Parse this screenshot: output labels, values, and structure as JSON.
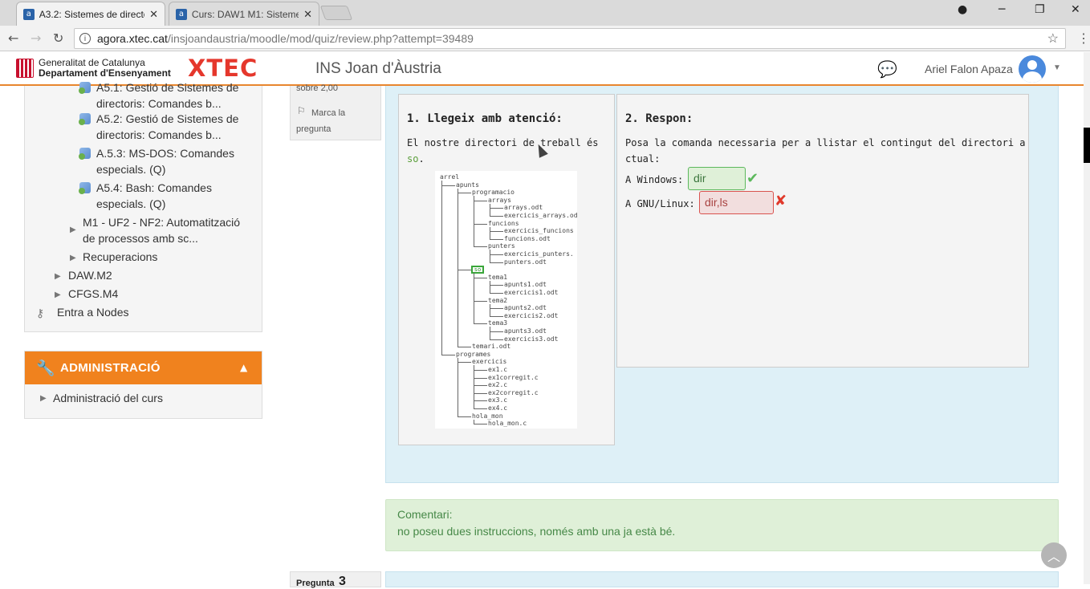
{
  "browser": {
    "tabs": [
      {
        "title": "A3.2: Sistemes de directo",
        "favicon": "a"
      },
      {
        "title": "Curs: DAW1 M1: Sistemes",
        "favicon": "a"
      }
    ],
    "url_host": "agora.xtec.cat",
    "url_path": "/insjoandaustria/moodle/mod/quiz/review.php?attempt=39489"
  },
  "header": {
    "gencat_line1": "Generalitat de Catalunya",
    "gencat_line2": "Departament d'Ensenyament",
    "xtec_logo": "XTEC",
    "site_name": "INS Joan d'Àustria",
    "user_name": "Ariel Falon Apaza",
    "chat_icon": "speech-bubble-icon"
  },
  "sidebar": {
    "items": [
      {
        "label1": "A5.1: Gestió de Sistemes de",
        "label2": "directoris: Comandes b..."
      },
      {
        "label1": "A5.2: Gestió de Sistemes de",
        "label2": "directoris: Comandes b..."
      },
      {
        "label1": "A.5.3: MS-DOS: Comandes",
        "label2": "especials. (Q)"
      },
      {
        "label1": "A5.4: Bash: Comandes",
        "label2": "especials. (Q)"
      }
    ],
    "section_uf2_line1": "M1 - UF2 - NF2: Automatització",
    "section_uf2_line2": "de processos amb sc...",
    "recuperacions": "Recuperacions",
    "daw_m2": "DAW.M2",
    "cfgs_m4": "CFGS.M4",
    "nodes": "Entra a Nodes"
  },
  "admin": {
    "title": "ADMINISTRACIÓ",
    "course_admin": "Administració del curs"
  },
  "question": {
    "mark_text": "sobre 2,00",
    "flag_text": "Marca la pregunta",
    "left_title": "1. Llegeix amb atenció:",
    "left_text1": "El nostre directori de treball és",
    "left_dir": "so",
    "right_title": "2. Respon:",
    "right_text1": "Posa la comanda necessaria per a llistar el contingut del directori a",
    "right_text2": "ctual:",
    "windows_label": "A Windows:",
    "windows_answer": "dir",
    "linux_label": "A GNU/Linux:",
    "linux_answer": "dir,ls"
  },
  "tree": {
    "labels": [
      "arrel",
      "apunts",
      "programacio",
      "arrays",
      "arrays.odt",
      "exercicis_arrays.odt",
      "funcions",
      "exercicis_funcions",
      "funcions.odt",
      "punters",
      "exercicis_punters.",
      "punters.odt",
      "so",
      "tema1",
      "apunts1.odt",
      "exercicis1.odt",
      "tema2",
      "apunts2.odt",
      "exercicis2.odt",
      "tema3",
      "apunts3.odt",
      "exercicis3.odt",
      "temari.odt",
      "programes",
      "exercicis",
      "ex1.c",
      "ex1corregit.c",
      "ex2.c",
      "ex2corregit.c",
      "ex3.c",
      "ex4.c",
      "hola_mon",
      "hola_mon.c"
    ]
  },
  "comment": {
    "label": "Comentari:",
    "text": "no poseu dues instruccions, només amb una ja està bé."
  },
  "next_question": {
    "label": "Pregunta",
    "number": "3"
  }
}
